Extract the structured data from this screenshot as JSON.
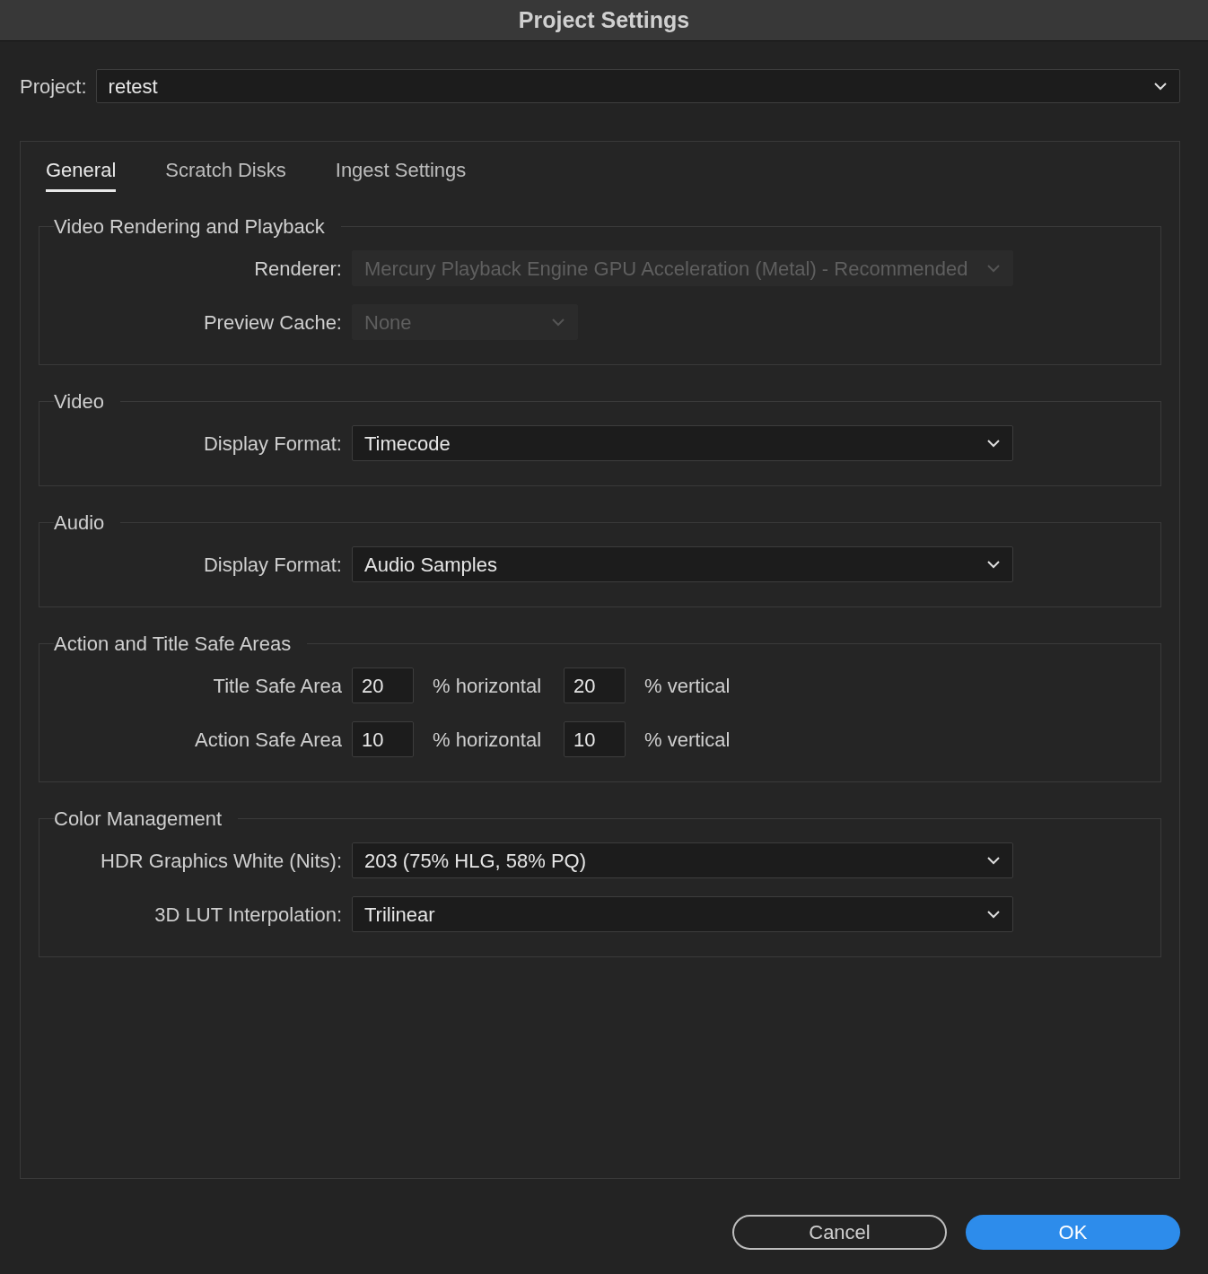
{
  "window": {
    "title": "Project Settings"
  },
  "project": {
    "label": "Project:",
    "value": "retest"
  },
  "tabs": [
    {
      "label": "General",
      "selected": true
    },
    {
      "label": "Scratch Disks",
      "selected": false
    },
    {
      "label": "Ingest Settings",
      "selected": false
    }
  ],
  "groups": [
    {
      "title": "Video Rendering and Playback",
      "rows": [
        {
          "kind": "dropdown",
          "label": "Renderer:",
          "value": "Mercury Playback Engine GPU Acceleration (Metal) - Recommended",
          "disabled": true
        },
        {
          "kind": "short_dropdown",
          "label": "Preview Cache:",
          "value": "None",
          "disabled": true
        }
      ]
    },
    {
      "title": "Video",
      "rows": [
        {
          "kind": "dropdown",
          "label": "Display Format:",
          "value": "Timecode",
          "disabled": false
        }
      ]
    },
    {
      "title": "Audio",
      "rows": [
        {
          "kind": "dropdown",
          "label": "Display Format:",
          "value": "Audio Samples",
          "disabled": false
        }
      ]
    },
    {
      "title": "Action and Title Safe Areas",
      "rows": [
        {
          "kind": "safe_area",
          "label": "Title Safe Area",
          "horizontal": "20",
          "horizontal_unit": "% horizontal",
          "vertical": "20",
          "vertical_unit": "% vertical"
        },
        {
          "kind": "safe_area",
          "label": "Action Safe Area",
          "horizontal": "10",
          "horizontal_unit": "% horizontal",
          "vertical": "10",
          "vertical_unit": "% vertical"
        }
      ]
    },
    {
      "title": "Color Management",
      "rows": [
        {
          "kind": "dropdown",
          "label": "HDR Graphics White (Nits):",
          "value": "203 (75% HLG, 58% PQ)",
          "disabled": false
        },
        {
          "kind": "dropdown",
          "label": "3D LUT Interpolation:",
          "value": "Trilinear",
          "disabled": false
        }
      ]
    }
  ],
  "buttons": [
    {
      "label": "Cancel",
      "kind": "secondary"
    },
    {
      "label": "OK",
      "kind": "primary"
    }
  ]
}
